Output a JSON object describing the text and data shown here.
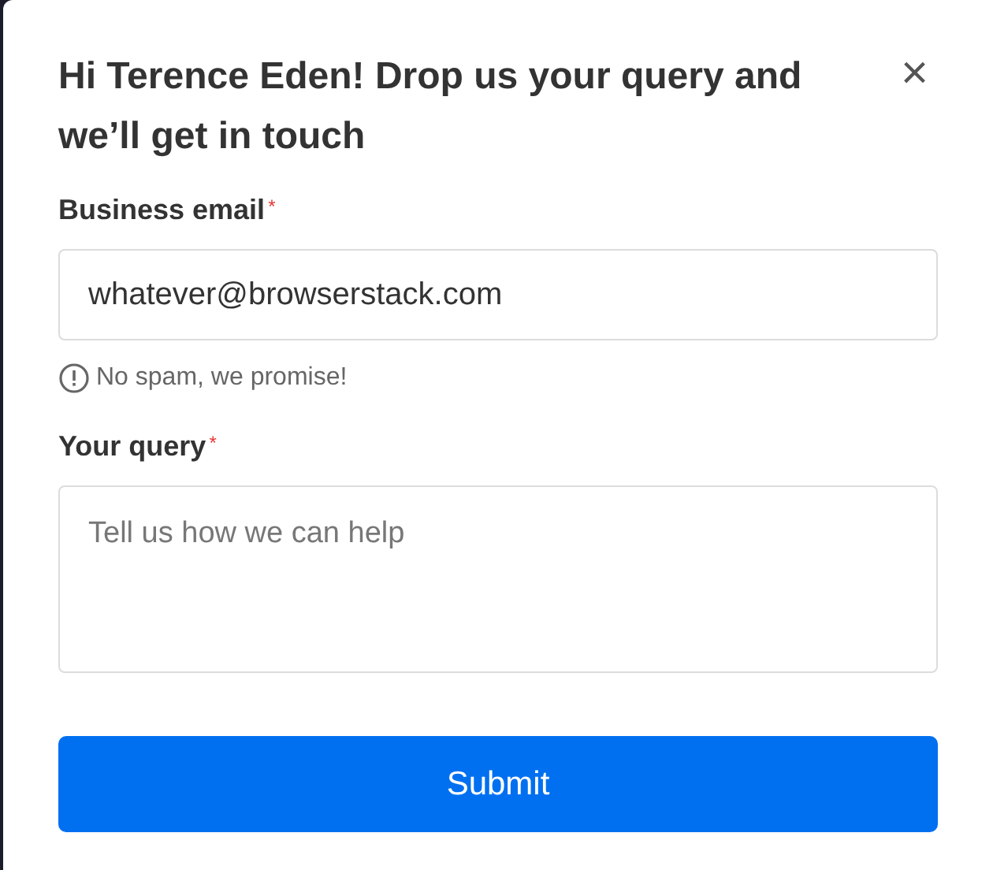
{
  "dialog": {
    "title": "Hi Terence Eden! Drop us your query and we’ll get in touch",
    "close": "×"
  },
  "fields": [
    {
      "kind": "input",
      "label": "Business email",
      "required": true,
      "required_mark": "*",
      "value": "whatever@browserstack.com",
      "hint": "No spam, we promise!"
    },
    {
      "kind": "textarea",
      "label": "Your query",
      "required": true,
      "required_mark": "*",
      "placeholder": "Tell us how we can help"
    }
  ],
  "submit": {
    "label": "Submit"
  }
}
